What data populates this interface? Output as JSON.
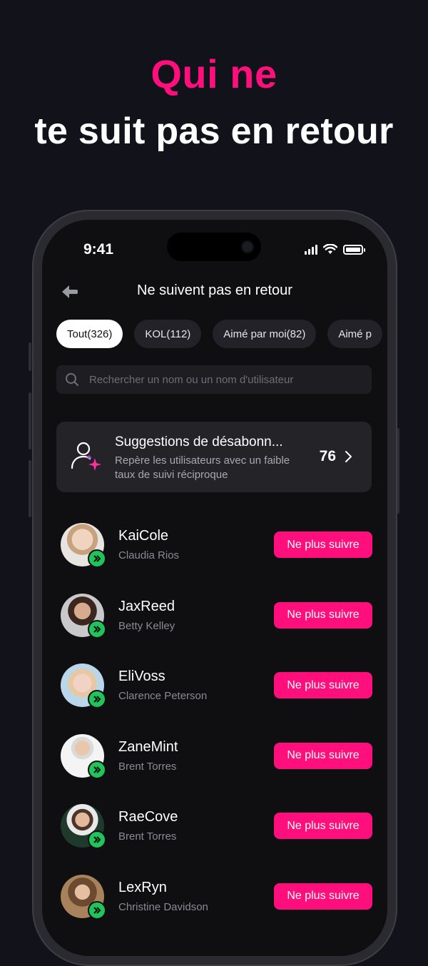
{
  "hero": {
    "line1": "Qui ne",
    "line2": "te suit pas en retour"
  },
  "status_bar": {
    "time": "9:41"
  },
  "header": {
    "title": "Ne suivent pas en retour",
    "back_icon": "arrow-left-icon"
  },
  "tabs": [
    {
      "label": "Tout(326)",
      "active": true
    },
    {
      "label": "KOL(112)",
      "active": false
    },
    {
      "label": "Aimé par moi(82)",
      "active": false
    },
    {
      "label": "Aimé p",
      "active": false
    }
  ],
  "search": {
    "placeholder": "Rechercher un nom ou un nom d'utilisateur",
    "icon": "search-icon"
  },
  "suggestion": {
    "title": "Suggestions de désabonn...",
    "subtitle": "Repère les utilisateurs avec un faible taux de suivi réciproque",
    "count": "76",
    "icon": "user-sparkle-icon"
  },
  "users": [
    {
      "username": "KaiCole",
      "name": "Claudia Rios",
      "button": "Ne plus suivre"
    },
    {
      "username": "JaxReed",
      "name": "Betty Kelley",
      "button": "Ne plus suivre"
    },
    {
      "username": "EliVoss",
      "name": "Clarence Peterson",
      "button": "Ne plus suivre"
    },
    {
      "username": "ZaneMint",
      "name": "Brent Torres",
      "button": "Ne plus suivre"
    },
    {
      "username": "RaeCove",
      "name": "Brent Torres",
      "button": "Ne plus suivre"
    },
    {
      "username": "LexRyn",
      "name": "Christine Davidson",
      "button": "Ne plus suivre"
    }
  ],
  "colors": {
    "accent": "#ff0f7b",
    "badge": "#21c35b",
    "background": "#12121b"
  }
}
